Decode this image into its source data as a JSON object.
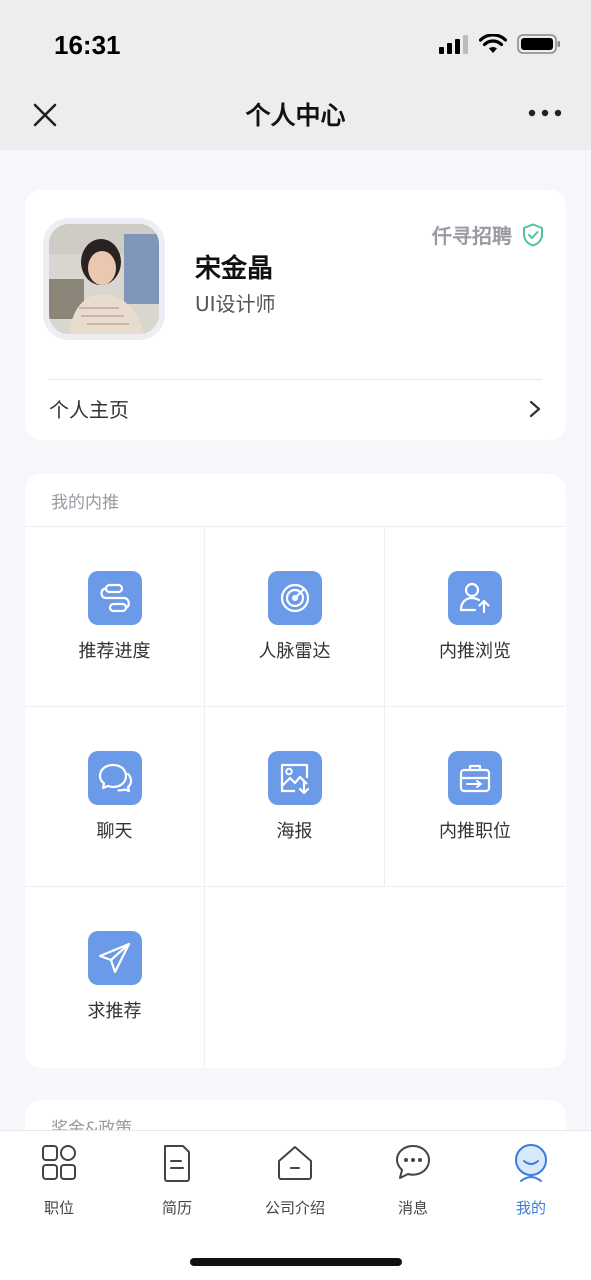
{
  "status": {
    "time": "16:31"
  },
  "nav": {
    "title": "个人中心"
  },
  "profile": {
    "name": "宋金晶",
    "title": "UI设计师",
    "company": "仟寻招聘",
    "homepage_label": "个人主页"
  },
  "referral": {
    "section_title": "我的内推",
    "items": [
      {
        "label": "推荐进度",
        "icon": "progress-icon"
      },
      {
        "label": "人脉雷达",
        "icon": "radar-icon"
      },
      {
        "label": "内推浏览",
        "icon": "user-upload-icon"
      },
      {
        "label": "聊天",
        "icon": "chat-icon"
      },
      {
        "label": "海报",
        "icon": "poster-icon"
      },
      {
        "label": "内推职位",
        "icon": "briefcase-icon"
      },
      {
        "label": "求推荐",
        "icon": "paper-plane-icon"
      }
    ]
  },
  "policy": {
    "section_title": "奖金&政策"
  },
  "tabs": [
    {
      "label": "职位",
      "icon": "grid-icon"
    },
    {
      "label": "简历",
      "icon": "document-icon"
    },
    {
      "label": "公司介绍",
      "icon": "home-icon"
    },
    {
      "label": "消息",
      "icon": "message-icon"
    },
    {
      "label": "我的",
      "icon": "profile-icon",
      "active": true
    }
  ],
  "colors": {
    "accent": "#6b9ae8",
    "active_tab": "#3a7be0",
    "verified": "#4fc3a1"
  }
}
